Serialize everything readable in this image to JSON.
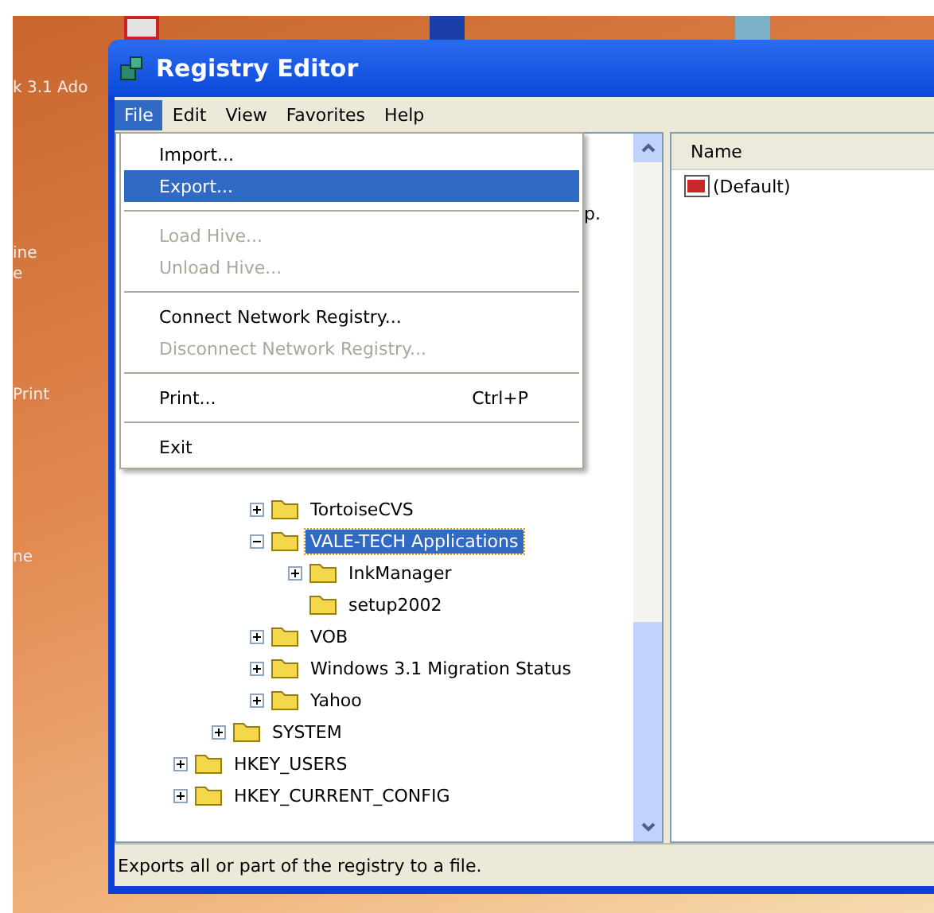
{
  "desktop": {
    "labels": [
      "k 3.1 Ado",
      "ine",
      "e",
      "Print",
      "ne"
    ]
  },
  "window": {
    "title": "Registry Editor"
  },
  "menubar": [
    {
      "label": "File",
      "selected": true
    },
    {
      "label": "Edit",
      "selected": false
    },
    {
      "label": "View",
      "selected": false
    },
    {
      "label": "Favorites",
      "selected": false
    },
    {
      "label": "Help",
      "selected": false
    }
  ],
  "file_menu": [
    {
      "kind": "item",
      "label": "Import...",
      "disabled": false,
      "selected": false
    },
    {
      "kind": "item",
      "label": "Export...",
      "disabled": false,
      "selected": true
    },
    {
      "kind": "separator"
    },
    {
      "kind": "item",
      "label": "Load Hive...",
      "disabled": true,
      "selected": false
    },
    {
      "kind": "item",
      "label": "Unload Hive...",
      "disabled": true,
      "selected": false
    },
    {
      "kind": "separator"
    },
    {
      "kind": "item",
      "label": "Connect Network Registry...",
      "disabled": false,
      "selected": false
    },
    {
      "kind": "item",
      "label": "Disconnect Network Registry...",
      "disabled": true,
      "selected": false
    },
    {
      "kind": "separator"
    },
    {
      "kind": "item",
      "label": "Print...",
      "shortcut": "Ctrl+P",
      "disabled": false,
      "selected": false
    },
    {
      "kind": "separator"
    },
    {
      "kind": "item",
      "label": "Exit",
      "disabled": false,
      "selected": false
    }
  ],
  "tree": {
    "covered_text": "p.",
    "children": [
      {
        "children": [
          {
            "children": [
              {
                "label": "TortoiseCVS",
                "expanded": false,
                "selected": false
              },
              {
                "label": "VALE-TECH Applications",
                "expanded": true,
                "selected": true,
                "children": [
                  {
                    "label": "InkManager",
                    "expanded": false,
                    "selected": false
                  },
                  {
                    "label": "setup2002",
                    "leaf": true,
                    "selected": false
                  }
                ]
              },
              {
                "label": "VOB",
                "expanded": false,
                "selected": false
              },
              {
                "label": "Windows 3.1 Migration Status",
                "expanded": false,
                "selected": false
              },
              {
                "label": "Yahoo",
                "expanded": false,
                "selected": false
              }
            ]
          },
          {
            "label": "SYSTEM",
            "expanded": false,
            "selected": false
          }
        ]
      },
      {
        "label": "HKEY_USERS",
        "expanded": false,
        "selected": false
      },
      {
        "label": "HKEY_CURRENT_CONFIG",
        "expanded": false,
        "selected": false
      }
    ]
  },
  "values": {
    "columns": [
      "Name"
    ],
    "rows": [
      {
        "name": "(Default)"
      }
    ]
  },
  "status_bar": "Exports all or part of the registry to a file."
}
